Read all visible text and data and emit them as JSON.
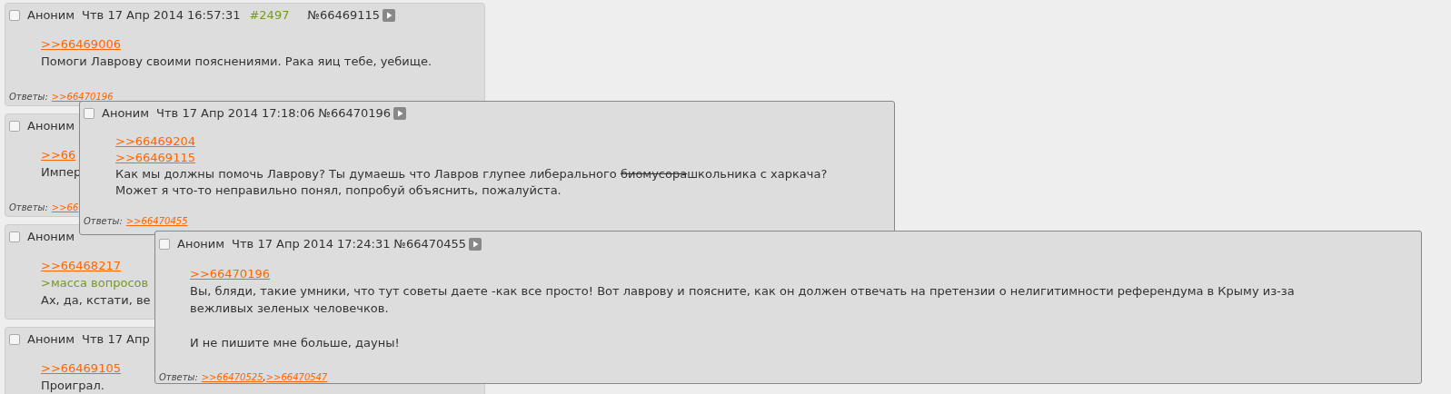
{
  "posts": [
    {
      "checked": false,
      "name": "Аноним",
      "date": "Чтв 17 Апр 2014 16:57:31",
      "ordinal": "#2497",
      "number": "№66469115",
      "body": [
        {
          "kind": "link",
          "text": ">>66469006"
        },
        {
          "kind": "text",
          "text": "Помоги Лаврову своими пояснениями. Рака яиц тебе, уебище."
        }
      ],
      "replies_label": "Ответы:",
      "replies": [
        ">>66470196"
      ]
    },
    {
      "checked": false,
      "name": "Аноним",
      "body": [
        {
          "kind": "link",
          "text": ">>66"
        },
        {
          "kind": "text",
          "text": "Импер"
        }
      ],
      "replies_label": "Ответы:",
      "replies": [
        ">>66"
      ]
    },
    {
      "checked": false,
      "name": "Аноним",
      "body": [
        {
          "kind": "link",
          "text": ">>66468217"
        },
        {
          "kind": "quote",
          "text": ">масса вопросов"
        },
        {
          "kind": "text",
          "text": "Ах, да, кстати, ве"
        }
      ]
    },
    {
      "checked": false,
      "name": "Аноним",
      "date": "Чтв 17 Апр",
      "body": [
        {
          "kind": "link",
          "text": ">>66469105"
        },
        {
          "kind": "text",
          "text": "Проиграл."
        }
      ]
    }
  ],
  "popups": [
    {
      "checked": false,
      "name": "Аноним",
      "date": "Чтв 17 Апр 2014 17:18:06",
      "number": "№66470196",
      "body": [
        {
          "kind": "link",
          "text": ">>66469204"
        },
        {
          "kind": "link",
          "text": ">>66469115"
        },
        {
          "kind": "rich",
          "segments": [
            {
              "text": "Как мы должны помочь Лаврову? Ты думаешь что Лавров глупее либерального ",
              "strike": false
            },
            {
              "text": "биомусора",
              "strike": true
            },
            {
              "text": "школьника с харкача?",
              "strike": false
            }
          ]
        },
        {
          "kind": "text",
          "text": "Может я что-то неправильно понял, попробуй объяснить, пожалуйста."
        }
      ],
      "replies_label": "Ответы:",
      "replies": [
        ">>66470455"
      ]
    },
    {
      "checked": false,
      "name": "Аноним",
      "date": "Чтв 17 Апр 2014 17:24:31",
      "number": "№66470455",
      "body": [
        {
          "kind": "link",
          "text": ">>66470196"
        },
        {
          "kind": "text",
          "text": "Вы, бляди, такие умники, что тут советы даете -как все просто! Вот лаврову и поясните, как он должен отвечать на претензии о нелигитимности референдума в Крыму из-за вежливых зеленых человечков.\n\nИ не пишите мне больше, дауны!"
        }
      ],
      "replies_label": "Ответы:",
      "replies": [
        ">>66470525",
        ">>66470547"
      ],
      "separator": ","
    }
  ]
}
